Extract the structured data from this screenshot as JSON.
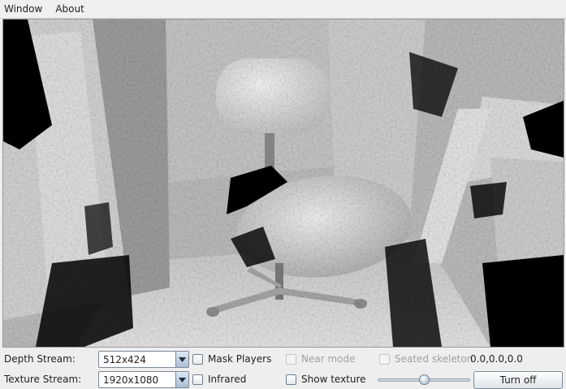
{
  "menu": [
    "Window",
    "About"
  ],
  "viewport": {
    "description_icon": "depth-pointcloud-render"
  },
  "controls": {
    "depth_stream_label": "Depth Stream:",
    "depth_stream_value": "512x424",
    "texture_stream_label": "Texture Stream:",
    "texture_stream_value": "1920x1080",
    "mask_players": "Mask Players",
    "near_mode": "Near mode",
    "seated_skeleton": "Seated skeleton",
    "coords": "0.0,0.0,0.0",
    "infrared": "Infrared",
    "show_texture": "Show texture",
    "slider_value": 0.5,
    "turn_off": "Turn off"
  }
}
